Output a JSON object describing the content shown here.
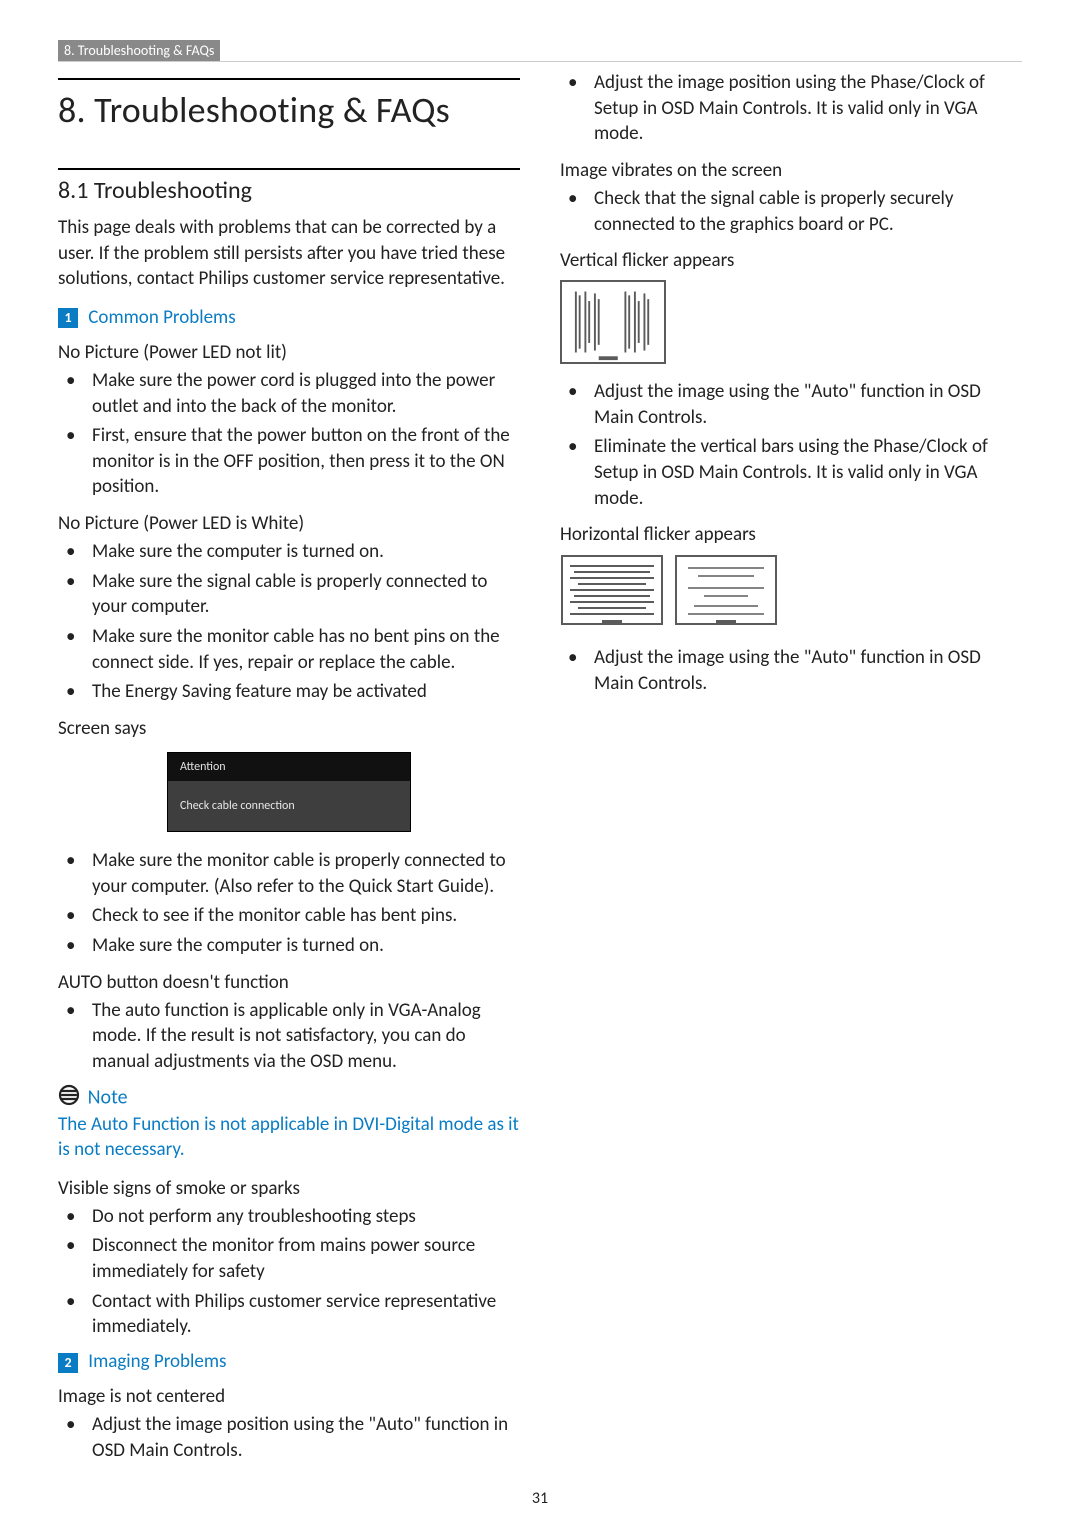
{
  "header": {
    "strip": "8. Troubleshooting & FAQs"
  },
  "title": "8.  Troubleshooting & FAQs",
  "section_8_1": {
    "heading": "8.1  Troubleshooting",
    "intro": "This page deals with problems that can be corrected by a user. If the problem still persists after you have tried these solutions, contact Philips customer service representative."
  },
  "common": {
    "num": "1",
    "label": "Common Problems",
    "no_pic_not_lit": {
      "heading": "No Picture (Power LED not lit)",
      "items": [
        "Make sure the power cord is plugged into the power outlet and into the back of the monitor.",
        "First, ensure that the power button on the front of the monitor is in the OFF position, then press it to the ON position."
      ]
    },
    "no_pic_white": {
      "heading": "No Picture (Power LED is White)",
      "items": [
        "Make sure the computer is turned on.",
        "Make sure the signal cable is properly connected to your computer.",
        "Make sure the monitor cable has no bent pins on the connect side. If yes, repair or replace the cable.",
        "The Energy Saving feature may be activated"
      ]
    },
    "screen_says": {
      "heading": "Screen says",
      "box_title": "Attention",
      "box_msg": "Check cable connection",
      "items_after": [
        "Make sure the monitor cable is properly connected to your computer. (Also refer to the Quick Start Guide).",
        "Check to see if the monitor cable has bent pins.",
        "Make sure the computer is turned on."
      ]
    },
    "auto_btn": {
      "heading": "AUTO button doesn't function",
      "items": [
        "The auto function is applicable only in VGA-Analog mode.  If the result is not satisfactory, you can do manual adjustments via the OSD menu."
      ]
    }
  },
  "note": {
    "label": "Note",
    "text": "The Auto Function is not applicable in DVI-Digital mode as it is not necessary."
  },
  "smoke": {
    "heading": "Visible signs of smoke or sparks",
    "items": [
      "Do not perform any troubleshooting steps",
      "Disconnect the monitor from mains power source immediately for safety",
      "Contact with Philips customer service representative immediately."
    ]
  },
  "imaging": {
    "num": "2",
    "label": "Imaging Problems",
    "not_centered": {
      "heading": "Image is not centered",
      "items": [
        "Adjust the image position using the \"Auto\" function in OSD Main Controls.",
        "Adjust the image position using the Phase/Clock of Setup in OSD Main Controls.  It is valid only in VGA mode."
      ]
    },
    "vibrates": {
      "heading": "Image vibrates on the screen",
      "items": [
        "Check that the signal cable is properly securely connected to the graphics board or PC."
      ]
    },
    "vflicker": {
      "heading": "Vertical flicker appears",
      "items": [
        "Adjust the image using the \"Auto\" function in OSD Main Controls.",
        "Eliminate the vertical bars using the Phase/Clock of Setup in OSD Main Controls. It is valid only in VGA mode."
      ]
    },
    "hflicker": {
      "heading": "Horizontal flicker appears",
      "items": [
        "Adjust the image using the \"Auto\" function in OSD Main Controls."
      ]
    }
  },
  "page_number": "31"
}
